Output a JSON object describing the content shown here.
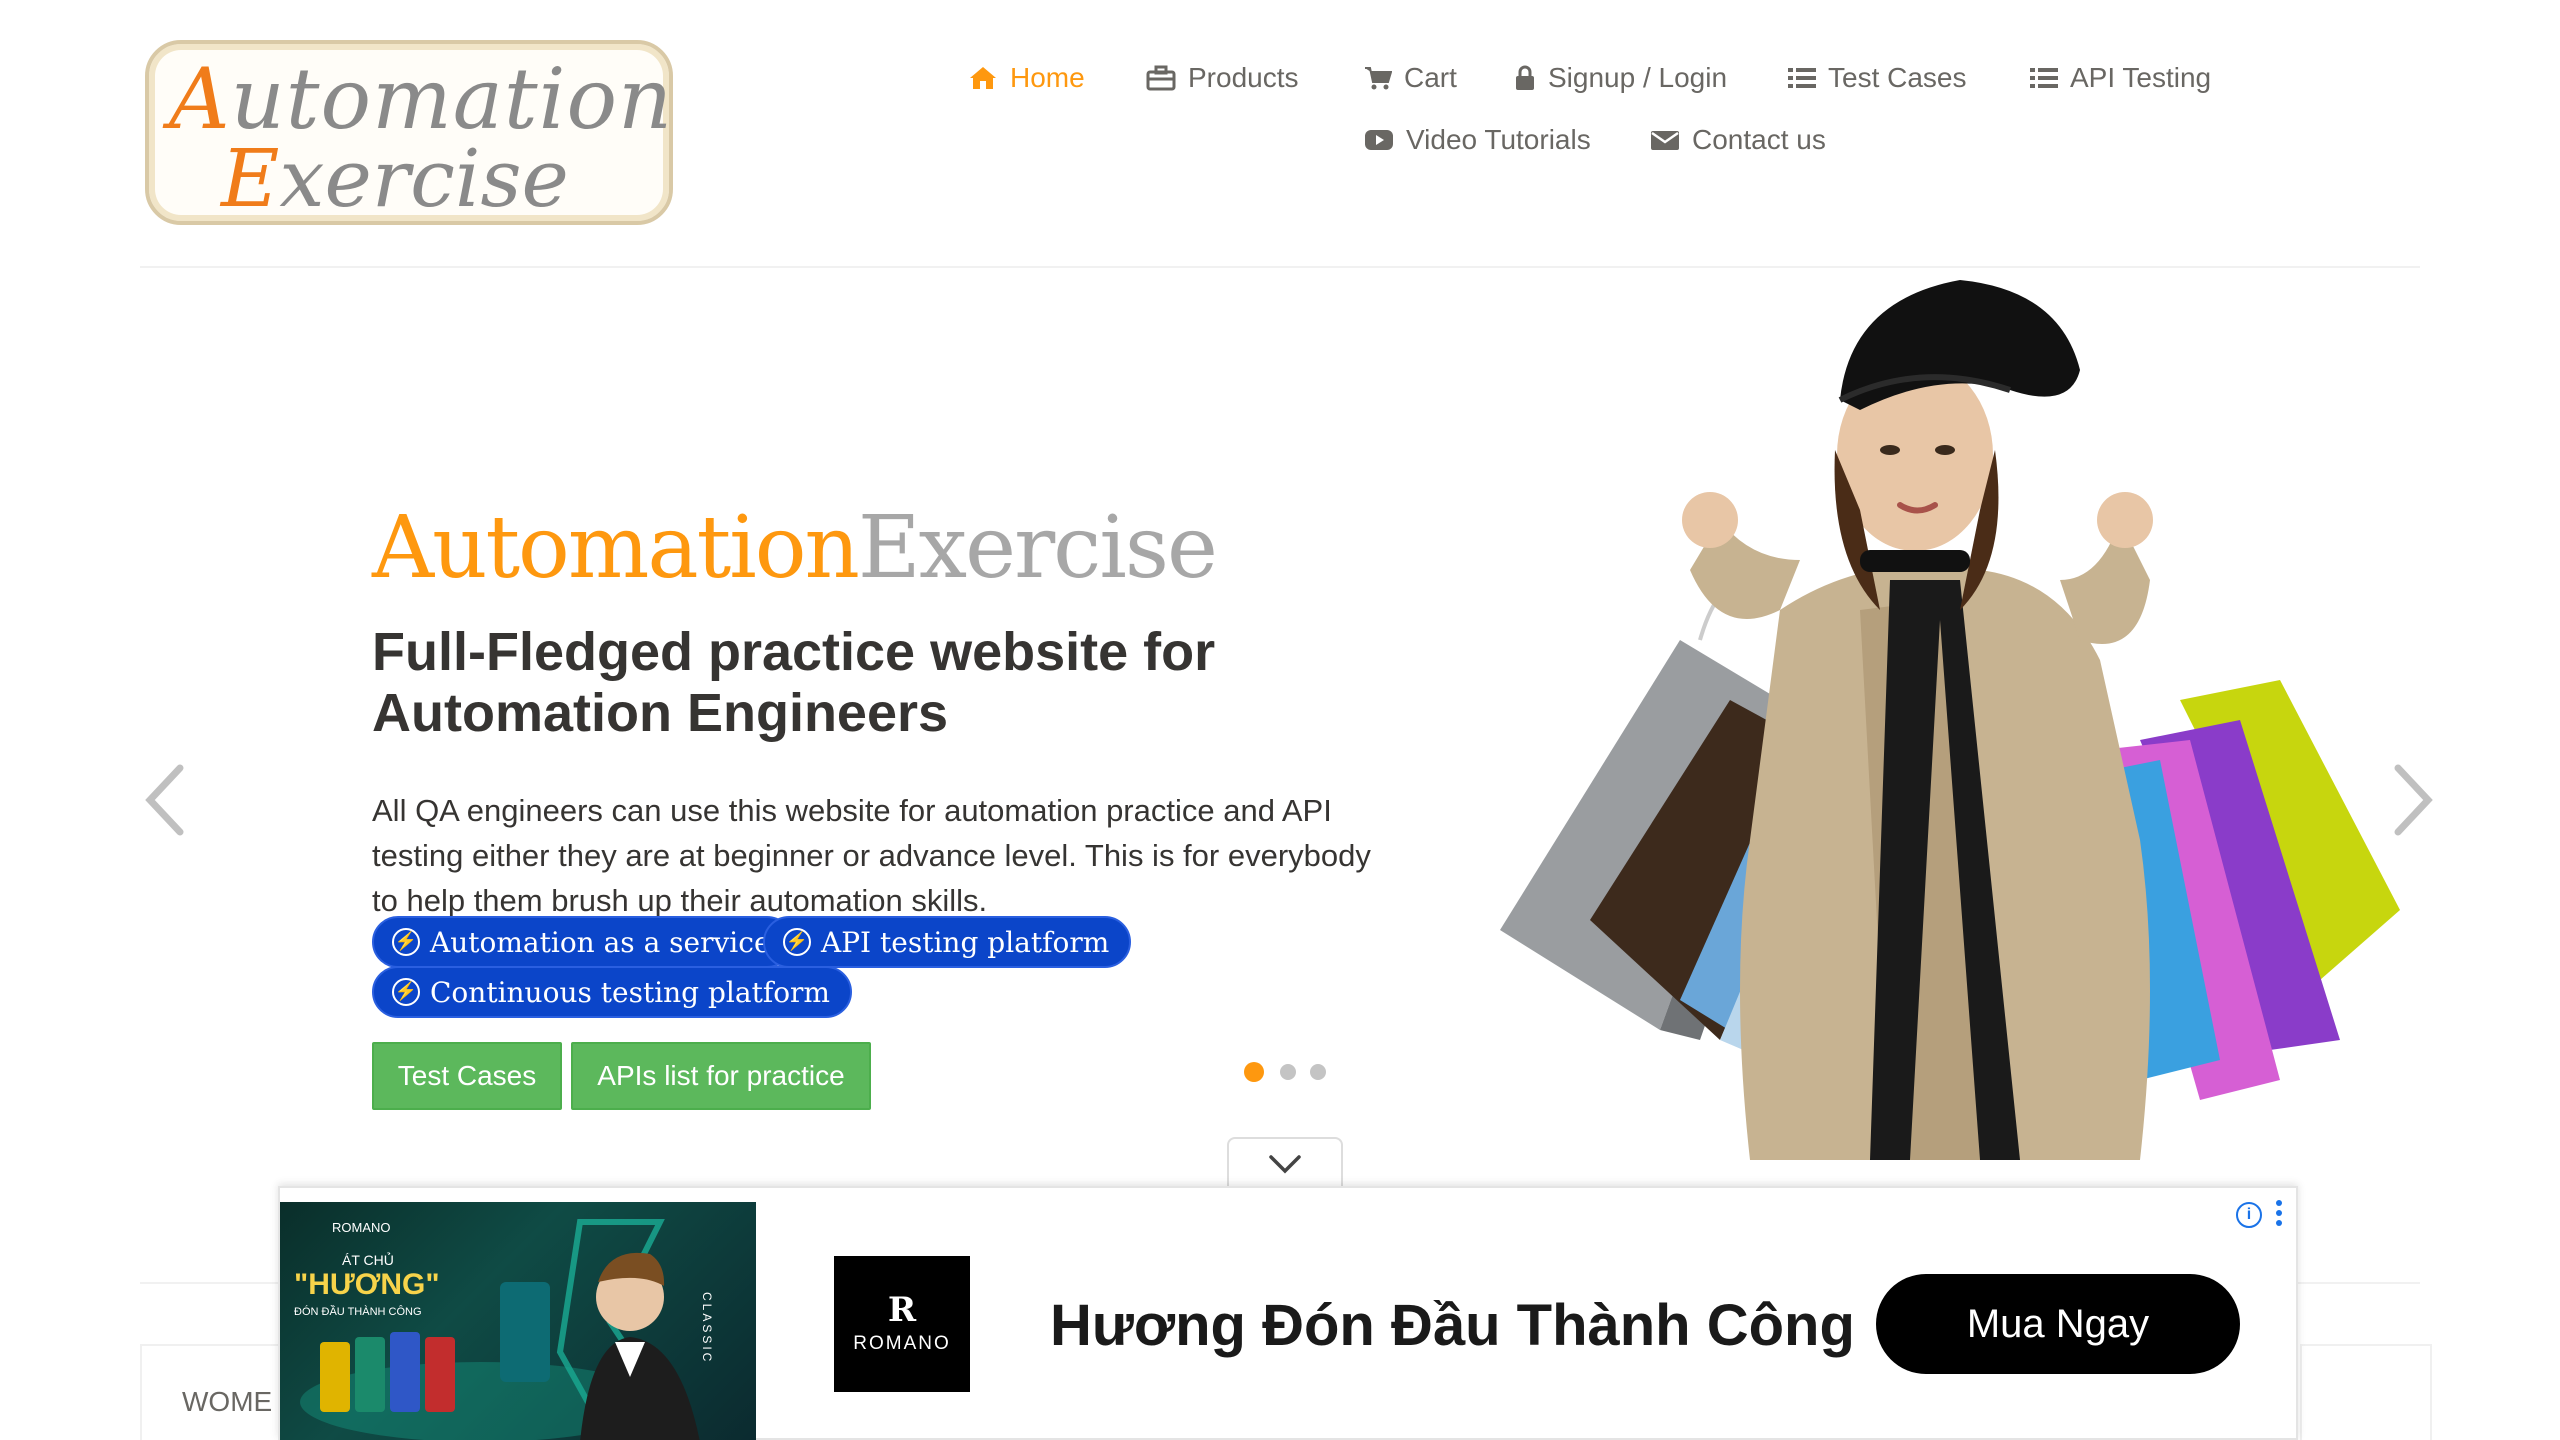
{
  "logo": {
    "line1_cap": "A",
    "line1_rest": "utomation",
    "line2_cap": "E",
    "line2_rest": "xercise"
  },
  "nav": {
    "home": "Home",
    "products": "Products",
    "cart": "Cart",
    "signup_login": "Signup / Login",
    "test_cases": "Test Cases",
    "api_testing": "API Testing",
    "video_tutorials": "Video Tutorials",
    "contact_us": "Contact us",
    "active_color": "#fe980f"
  },
  "hero": {
    "title_part1": "Automation",
    "title_part2": "Exercise",
    "subtitle": "Full-Fledged practice website for Automation Engineers",
    "description": "All QA engineers can use this website for automation practice and API testing either they are at beginner or advance level. This is for everybody to help them brush up their automation skills.",
    "pills": [
      "Automation as a service",
      "API testing platform",
      "Continuous testing platform"
    ],
    "buttons": {
      "test_cases": "Test Cases",
      "apis_list": "APIs list for practice"
    },
    "carousel": {
      "slides": 3,
      "active_slide": 1
    }
  },
  "categories": {
    "first_label": "WOME"
  },
  "ad": {
    "brand": "ROMANO",
    "logo_letter": "R",
    "image_small_text": "ROMANO",
    "image_line1": "ÁT CHỦ",
    "image_line2": "\"HƯƠNG\"",
    "image_line3": "ĐÓN ĐẦU THÀNH CÔNG",
    "image_side": "CLASSIC",
    "headline": "Hương Đón Đầu Thành Công",
    "cta": "Mua Ngay",
    "info": "i"
  }
}
